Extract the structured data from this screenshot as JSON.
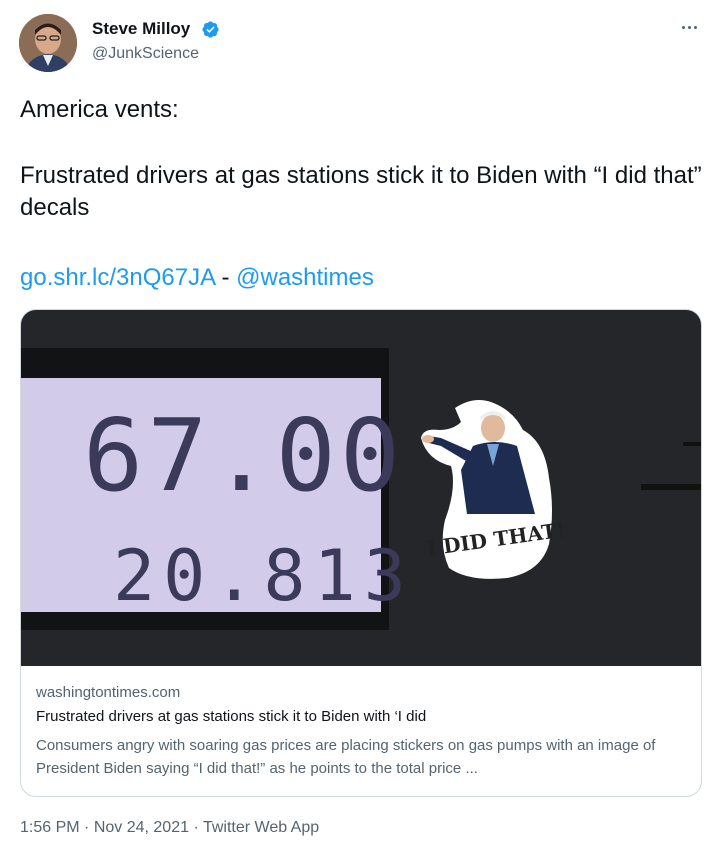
{
  "author": {
    "name": "Steve Milloy",
    "handle": "@JunkScience"
  },
  "tweet": {
    "line1": "America vents:",
    "line2": "Frustrated drivers at gas stations stick it to Biden with “I did that” decals",
    "link_url": "go.shr.lc/3nQ67JA",
    "separator": " - ",
    "mention": "@washtimes"
  },
  "card": {
    "image": {
      "pump_amount": "67.00",
      "pump_gallons": "20.813",
      "sticker_text": "I DID THAT!"
    },
    "domain": "washingtontimes.com",
    "title": "Frustrated drivers at gas stations stick it to Biden with ‘I did",
    "description": "Consumers angry with soaring gas prices are placing stickers on gas pumps with an image of President Biden saying “I did that!” as he points to the total price ..."
  },
  "meta": {
    "time": "1:56 PM",
    "dot1": " · ",
    "date": "Nov 24, 2021",
    "dot2": " · ",
    "source": "Twitter Web App"
  },
  "colors": {
    "link": "#1d9bf0",
    "verified": "#1d9bf0",
    "secondary_text": "#536471",
    "border": "#cfd9de"
  },
  "icons": [
    "verified-badge-icon",
    "more-options-icon"
  ]
}
